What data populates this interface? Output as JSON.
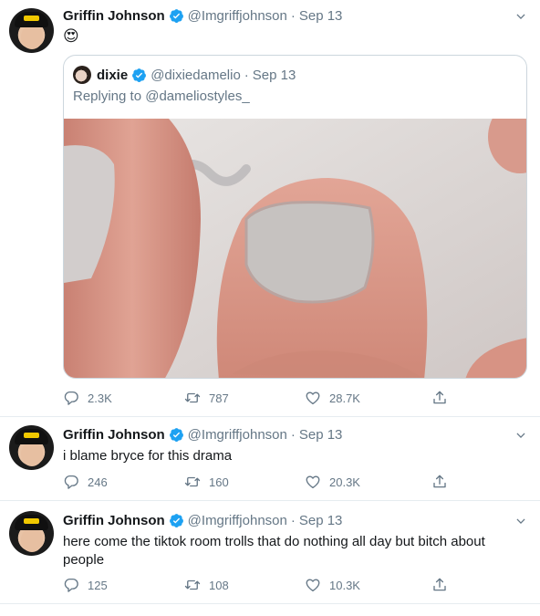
{
  "tweets": [
    {
      "name": "Griffin Johnson",
      "handle": "@Imgriffjohnson",
      "dot": "·",
      "date": "Sep 13",
      "text": "😍",
      "quote": {
        "name": "dixie",
        "handle": "@dixiedamelio",
        "dot": "·",
        "date": "Sep 13",
        "replying_prefix": "Replying to",
        "replying_to": "@dameliostyles_"
      },
      "replies": "2.3K",
      "retweets": "787",
      "likes": "28.7K"
    },
    {
      "name": "Griffin Johnson",
      "handle": "@Imgriffjohnson",
      "dot": "·",
      "date": "Sep 13",
      "text": "i blame bryce for this drama",
      "replies": "246",
      "retweets": "160",
      "likes": "20.3K"
    },
    {
      "name": "Griffin Johnson",
      "handle": "@Imgriffjohnson",
      "dot": "·",
      "date": "Sep 13",
      "text": "here come the tiktok room trolls that do nothing all day but bitch about people",
      "replies": "125",
      "retweets": "108",
      "likes": "10.3K"
    }
  ],
  "icons": {
    "verified": "verified-badge-icon",
    "caret": "chevron-down-icon",
    "reply": "reply-icon",
    "retweet": "retweet-icon",
    "like": "heart-icon",
    "share": "share-icon"
  },
  "colors": {
    "verified_blue": "#1da1f2",
    "muted_text": "#657786",
    "border": "#e6ecf0"
  }
}
